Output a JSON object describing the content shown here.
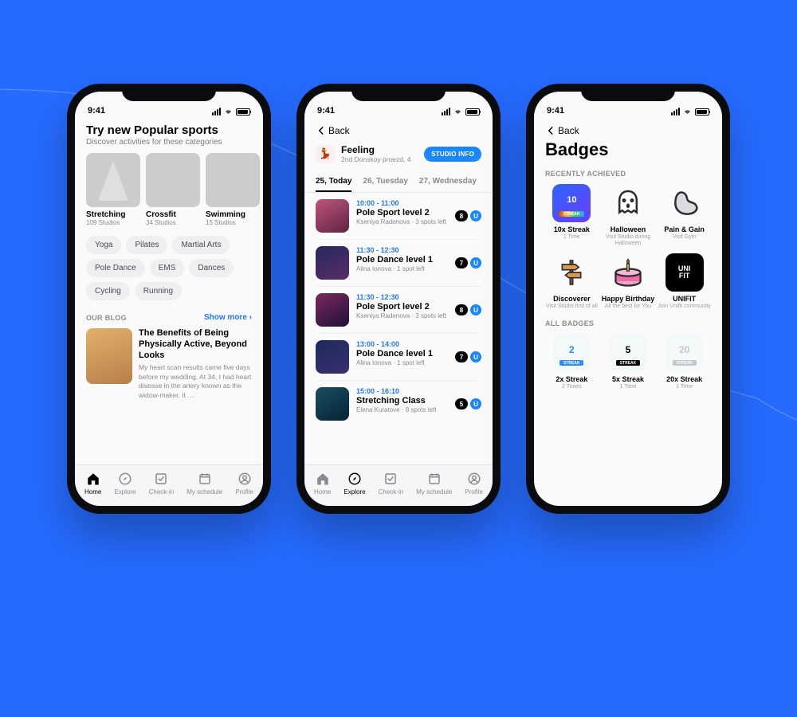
{
  "status": {
    "time": "9:41"
  },
  "tabbar": [
    "Home",
    "Explore",
    "Check-in",
    "My schedule",
    "Profile"
  ],
  "phone1": {
    "title": "Try new Popular sports",
    "subtitle": "Discover activities for these categories",
    "cards": [
      {
        "name": "Stretching",
        "sub": "109 Studios"
      },
      {
        "name": "Crossfit",
        "sub": "34 Studios"
      },
      {
        "name": "Swimming",
        "sub": "15 Studios"
      }
    ],
    "chips": [
      "Yoga",
      "Pilates",
      "Martial Arts",
      "Pole Dance",
      "EMS",
      "Dances",
      "Cycling",
      "Running"
    ],
    "blog_heading": "OUR BLOG",
    "show_more": "Show more",
    "blog_title": "The Benefits of Being Physically Active, Beyond Looks",
    "blog_desc": "My heart scan results came five days before my wedding. At 34, I had heart disease in the artery known as the widow-maker. It …"
  },
  "phone2": {
    "back": "Back",
    "studio_name": "Feeling",
    "studio_addr": "2nd Donskoy proezd, 4",
    "studio_btn": "STUDIO INFO",
    "days": [
      "25, Today",
      "26, Tuesday",
      "27, Wednesday"
    ],
    "classes": [
      {
        "time": "10:00 - 11:00",
        "title": "Pole Sport level 2",
        "sub": "Kseniya Radenova · 3 spots left",
        "n": "8",
        "img": "a"
      },
      {
        "time": "11:30 - 12:30",
        "title": "Pole Dance level 1",
        "sub": "Alina Ionova · 1 spot left",
        "n": "7",
        "img": "b"
      },
      {
        "time": "11:30 - 12:30",
        "title": "Pole Sport level 2",
        "sub": "Kseniya Radenova · 3 spots left",
        "n": "8",
        "img": "c"
      },
      {
        "time": "13:00 - 14:00",
        "title": "Pole Dance level 1",
        "sub": "Alina Ionova · 1 spot left",
        "n": "7",
        "img": "d"
      },
      {
        "time": "15:00 - 16:10",
        "title": "Stretching Class",
        "sub": "Elena Kuratove · 8 spots left",
        "n": "5",
        "img": "e"
      }
    ]
  },
  "phone3": {
    "back": "Back",
    "title": "Badges",
    "recent_heading": "RECENTLY ACHIEVED",
    "all_heading": "ALL BADGES",
    "recent": [
      {
        "name": "10x Streak",
        "desc": "1 Time"
      },
      {
        "name": "Halloween",
        "desc": "Visit Studio during Halloween"
      },
      {
        "name": "Pain & Gain",
        "desc": "Visit Gym"
      },
      {
        "name": "Discoverer",
        "desc": "Visit Studio first of all"
      },
      {
        "name": "Happy Birthday",
        "desc": "All the best for You"
      },
      {
        "name": "UNIFIT",
        "desc": "Join Unifit community"
      }
    ],
    "all": [
      {
        "name": "2x Streak",
        "desc": "2 Times"
      },
      {
        "name": "5x Streak",
        "desc": "1 Time"
      },
      {
        "name": "20x Streak",
        "desc": "1 Time"
      }
    ],
    "streak_label": "STREAK"
  }
}
